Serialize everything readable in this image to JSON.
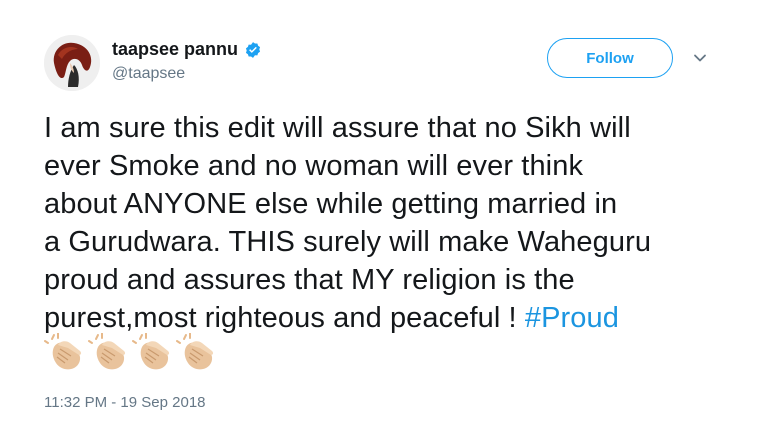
{
  "user": {
    "display_name": "taapsee pannu",
    "handle": "@taapsee",
    "avatar_icon": "profile-photo",
    "verified_icon": "verified-badge-icon"
  },
  "header": {
    "follow_label": "Follow",
    "menu_icon": "chevron-down-icon"
  },
  "tweet": {
    "line1": "I am sure this edit will assure that no Sikh will",
    "line2": "ever Smoke and no woman will ever think",
    "line3": "about ANYONE else while getting married in",
    "line4": "a Gurudwara. THIS surely will make Waheguru",
    "line5": "proud and assures that MY religion is the",
    "line6_text": "purest,most righteous and peaceful ! ",
    "hashtag": "#Proud",
    "emoji": [
      "clapping-hands",
      "clapping-hands",
      "clapping-hands",
      "clapping-hands"
    ],
    "timestamp": "11:32 PM - 19 Sep 2018"
  },
  "colors": {
    "accent": "#1da1f2",
    "hashtag": "#1b95e0",
    "secondary_text": "#657786",
    "primary_text": "#14171a"
  }
}
